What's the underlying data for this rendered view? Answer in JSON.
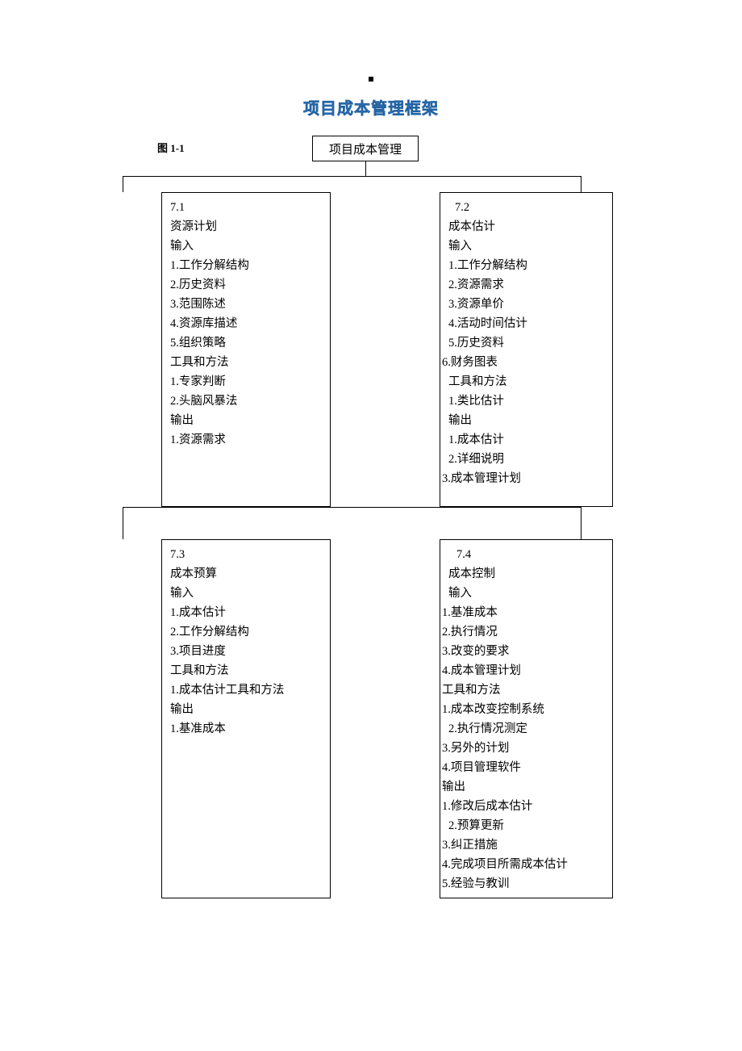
{
  "title": "项目成本管理框架",
  "figure_label": "图 1-1",
  "root": "项目成本管理",
  "box71": {
    "num": "7.1",
    "name": "资源计划",
    "sec_input": "输入",
    "in1": "1.工作分解结构",
    "in2": "2.历史资料",
    "in3": "3.范围陈述",
    "in4": "4.资源库描述",
    "in5": "5.组织策略",
    "sec_tools": "工具和方法",
    "t1": "1.专家判断",
    "t2": "2.头脑风暴法",
    "sec_output": "输出",
    "o1": "1.资源需求"
  },
  "box72": {
    "num": "7.2",
    "name": "成本估计",
    "sec_input": "输入",
    "in1": "1.工作分解结构",
    "in2": "2.资源需求",
    "in3": "3.资源单价",
    "in4": "4.活动时间估计",
    "in5": "5.历史资料",
    "in6": "6.财务图表",
    "sec_tools": "工具和方法",
    "t1": "1.类比估计",
    "sec_output": "输出",
    "o1": "1.成本估计",
    "o2": "2.详细说明",
    "o3": "3.成本管理计划"
  },
  "box73": {
    "num": "7.3",
    "name": "成本预算",
    "sec_input": "输入",
    "in1": "1.成本估计",
    "in2": "2.工作分解结构",
    "in3": "3.项目进度",
    "sec_tools": "工具和方法",
    "t1": "1.成本估计工具和方法",
    "sec_output": "输出",
    "o1": "1.基准成本"
  },
  "box74": {
    "num": "7.4",
    "name": "成本控制",
    "sec_input": "输入",
    "in1": "1.基准成本",
    "in2": "2.执行情况",
    "in3": "3.改变的要求",
    "in4": "4.成本管理计划",
    "sec_tools": "工具和方法",
    "t1": "1.成本改变控制系统",
    "t2": "2.执行情况测定",
    "t3": "3.另外的计划",
    "t4": "4.项目管理软件",
    "sec_output": "输出",
    "o1": "1.修改后成本估计",
    "o2": "2.预算更新",
    "o3": "3.纠正措施",
    "o4": "4.完成项目所需成本估计",
    "o5": "5.经验与教训"
  }
}
